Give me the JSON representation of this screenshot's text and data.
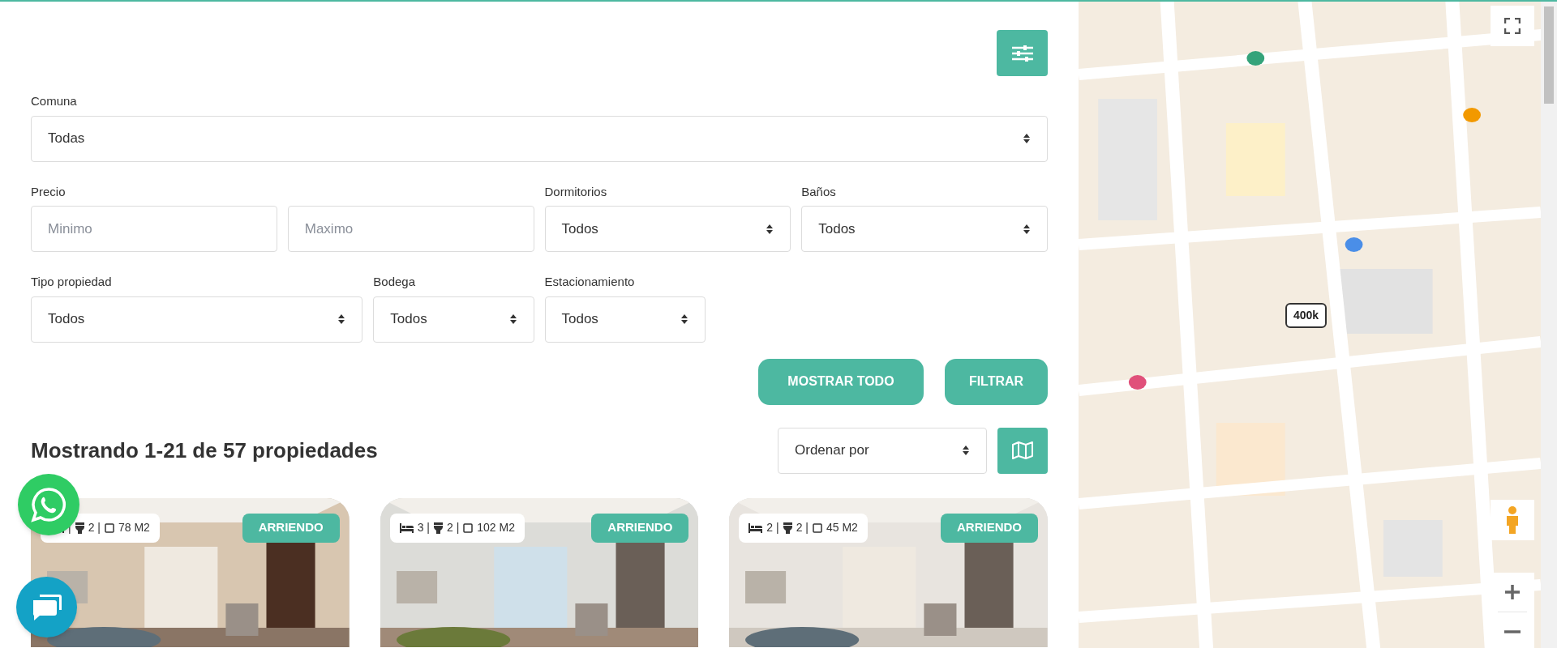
{
  "filters": [
    {
      "kind": "select",
      "label": "Comuna",
      "value": "Todas"
    },
    {
      "kind": "range",
      "label": "Precio",
      "placeholders": [
        "Minimo",
        "Maximo"
      ]
    },
    {
      "kind": "select",
      "label": "Dormitorios",
      "value": "Todos"
    },
    {
      "kind": "select",
      "label": "Baños",
      "value": "Todos"
    },
    {
      "kind": "select",
      "label": "Tipo propiedad",
      "value": "Todos"
    },
    {
      "kind": "select",
      "label": "Bodega",
      "value": "Todos"
    },
    {
      "kind": "select",
      "label": "Estacionamiento",
      "value": "Todos"
    }
  ],
  "actions": [
    "MOSTRAR TODO",
    "FILTRAR"
  ],
  "results": {
    "heading": "Mostrando 1-21 de 57 propiedades",
    "sort": "Ordenar por"
  },
  "cards": [
    {
      "beds": "|",
      "baths": "2 |",
      "area": "78 M2",
      "badge": "ARRIENDO"
    },
    {
      "beds": "3 |",
      "baths": "2 |",
      "area": "102 M2",
      "badge": "ARRIENDO"
    },
    {
      "beds": "2 |",
      "baths": "2 |",
      "area": "45 M2",
      "badge": "ARRIENDO"
    }
  ],
  "map": {
    "marker": "400k"
  }
}
